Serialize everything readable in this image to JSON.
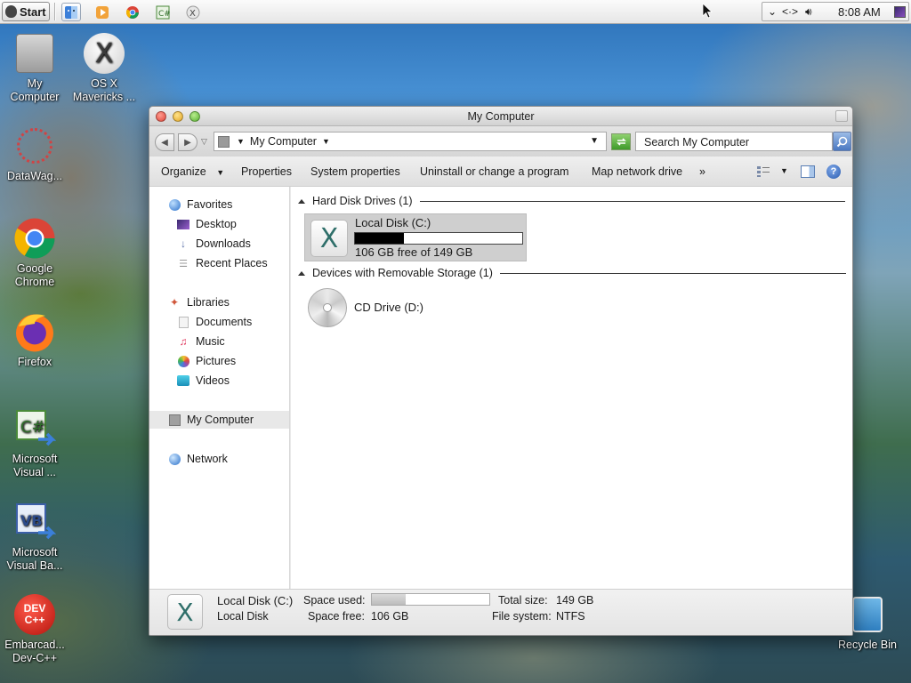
{
  "taskbar": {
    "start_label": "Start",
    "pinned": [
      "finder-icon",
      "media-player-icon",
      "chrome-icon",
      "csharp-icon",
      "osx-icon"
    ],
    "clock": "8:08 AM"
  },
  "desktop": {
    "icons": [
      {
        "label": "My Computer"
      },
      {
        "label": "OS X Mavericks ..."
      },
      {
        "label": "DataWag..."
      },
      {
        "label": "Google Chrome"
      },
      {
        "label": "Firefox"
      },
      {
        "label": "Microsoft Visual ..."
      },
      {
        "label": "Microsoft Visual Ba..."
      },
      {
        "label": "Embarcad... Dev-C++"
      },
      {
        "label": "Recycle Bin"
      }
    ]
  },
  "window": {
    "title": "My Computer",
    "address": "My Computer",
    "search_placeholder": "Search My Computer",
    "commands": [
      "Organize",
      "Properties",
      "System properties",
      "Uninstall or change a program",
      "Map network drive",
      "»"
    ],
    "nav": {
      "favorites": "Favorites",
      "desktop": "Desktop",
      "downloads": "Downloads",
      "recent": "Recent Places",
      "libraries": "Libraries",
      "documents": "Documents",
      "music": "Music",
      "pictures": "Pictures",
      "videos": "Videos",
      "my_computer": "My Computer",
      "network": "Network"
    },
    "groups": {
      "hdd": "Hard Disk Drives (1)",
      "removable": "Devices with Removable Storage (1)"
    },
    "drive_c": {
      "name": "Local Disk (C:)",
      "free_text": "106 GB free of 149 GB",
      "used_fraction": 0.29
    },
    "drive_d": {
      "name": "CD Drive (D:)"
    },
    "details": {
      "name": "Local Disk (C:)",
      "type": "Local Disk",
      "space_used_label": "Space used:",
      "space_free_label": "Space free:",
      "space_free_value": "106 GB",
      "total_size_label": "Total size:",
      "total_size_value": "149 GB",
      "file_system_label": "File system:",
      "file_system_value": "NTFS"
    },
    "colors": {
      "selection": "#cfcfcf",
      "accent_blue": "#4a78c2"
    }
  }
}
